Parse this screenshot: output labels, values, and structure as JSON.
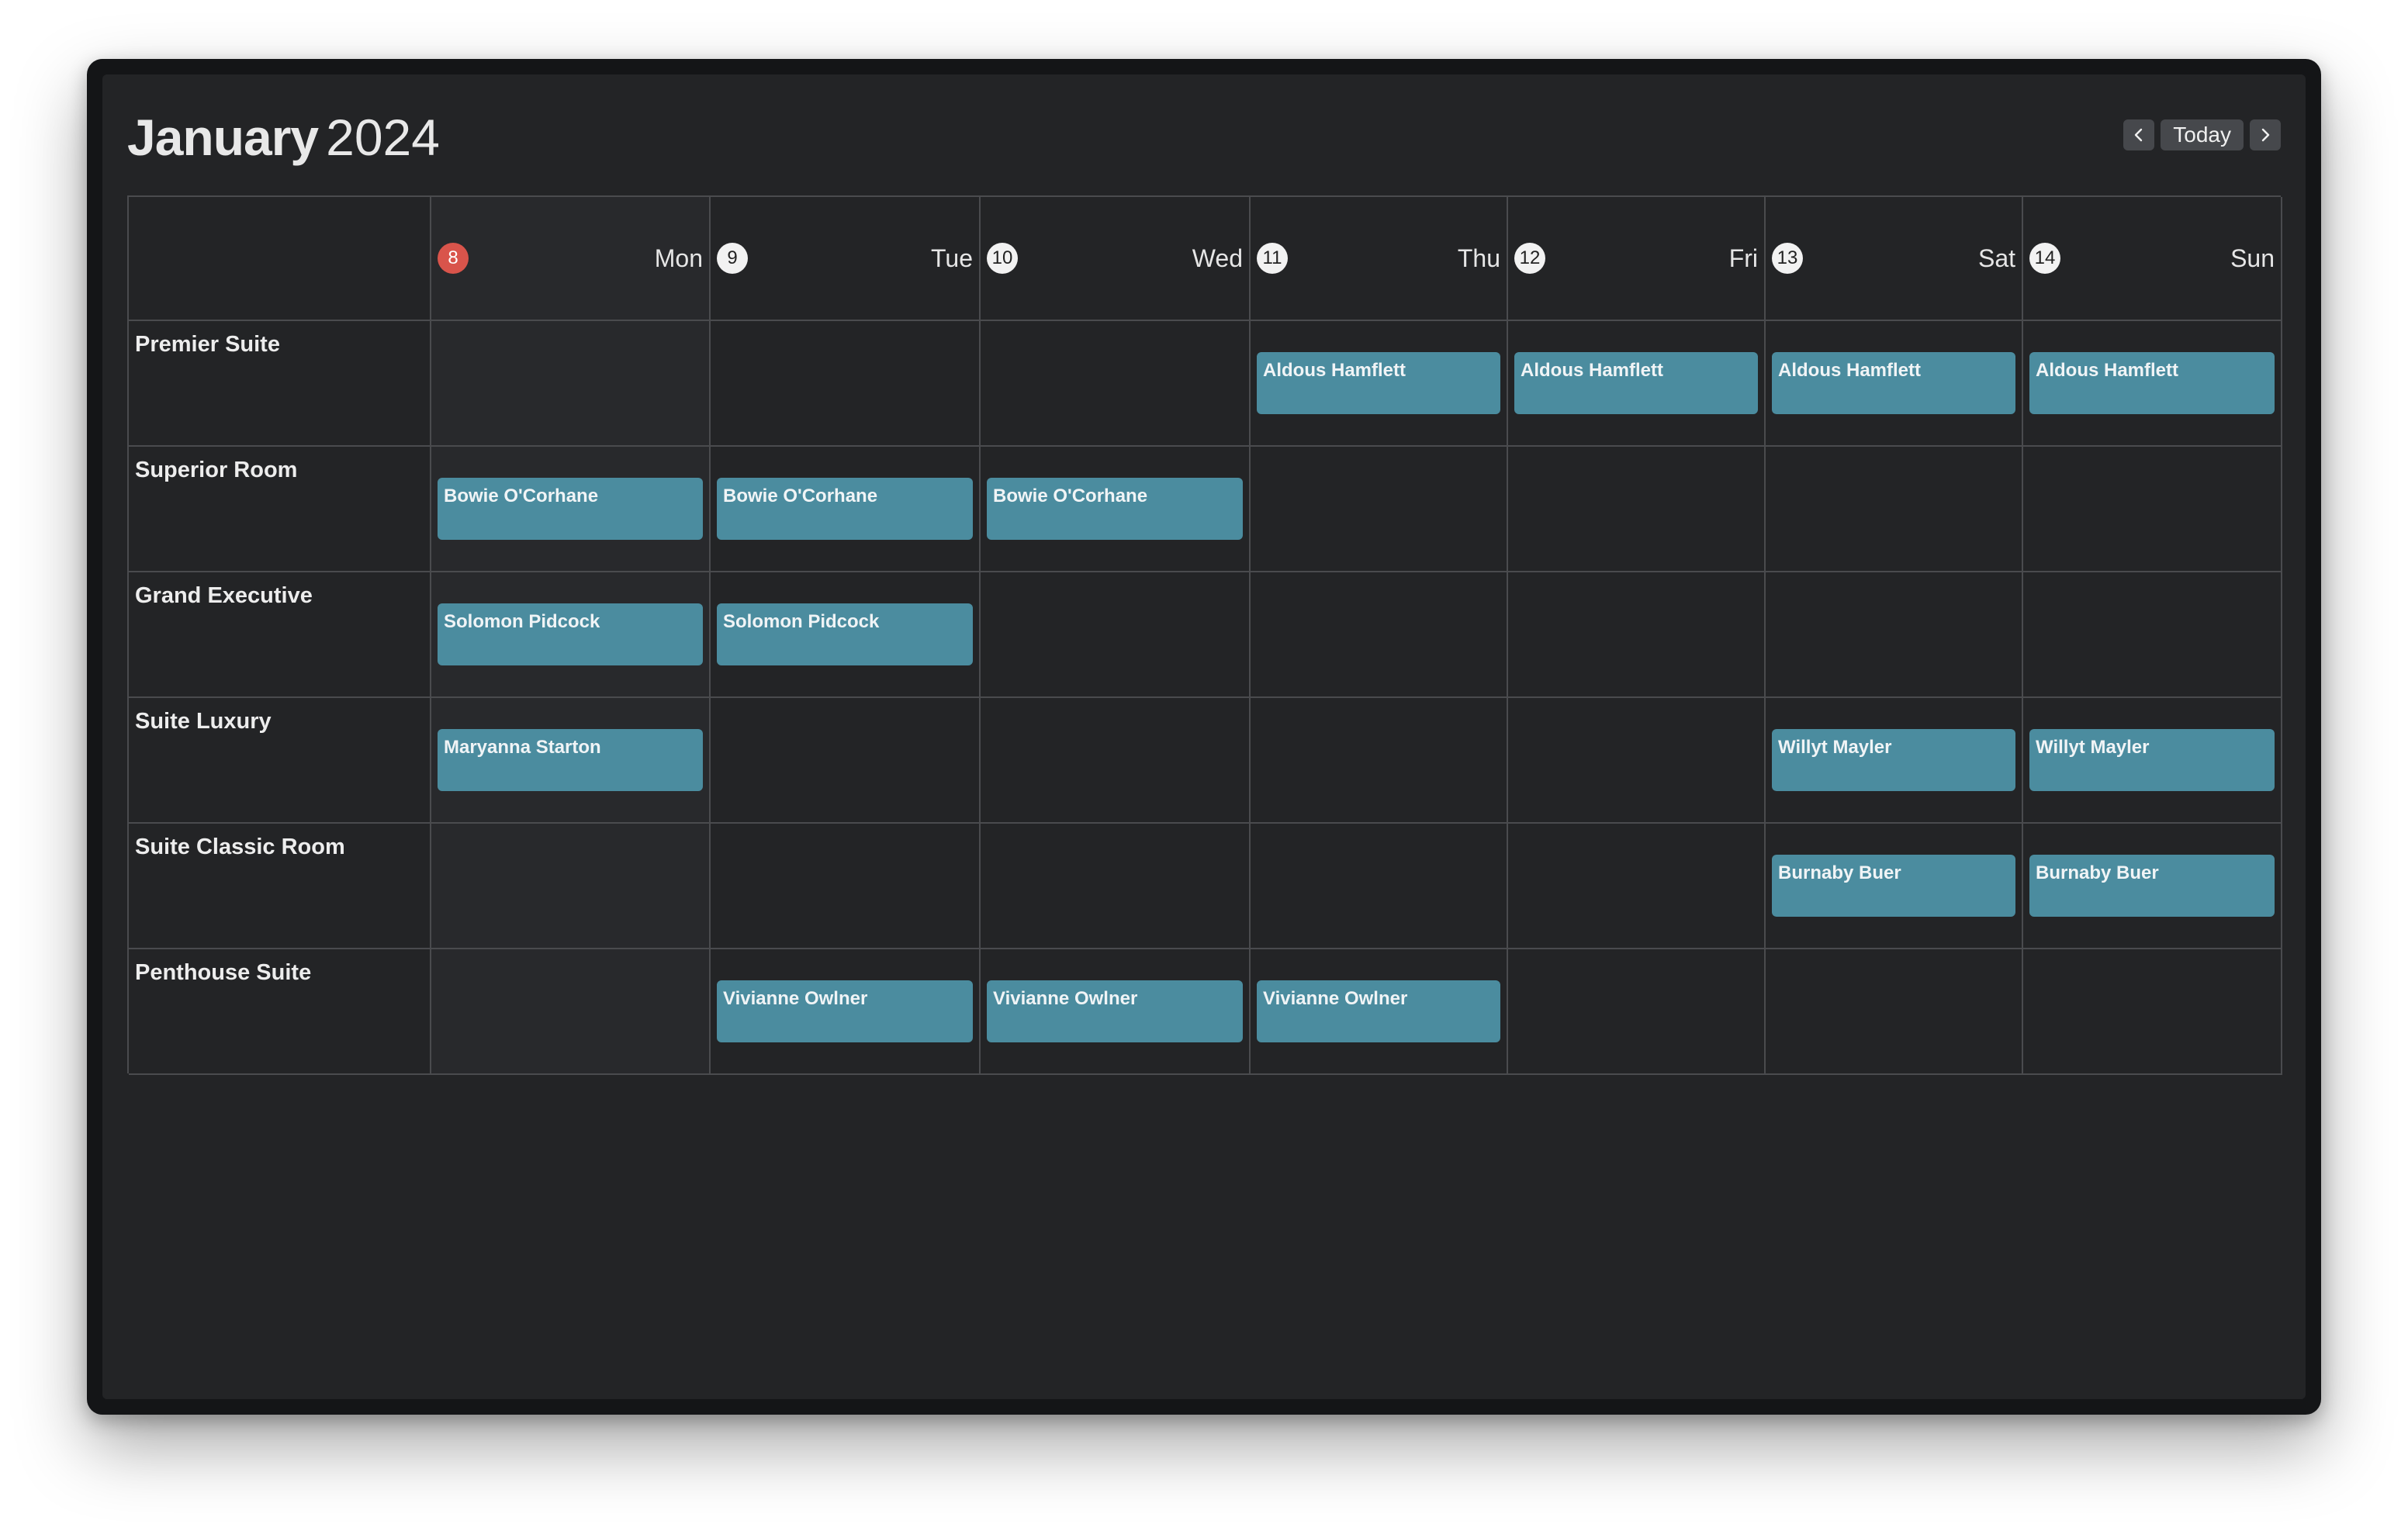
{
  "header": {
    "month": "January",
    "year": "2024",
    "nav": {
      "prev_icon": "chevron-left-icon",
      "today_label": "Today",
      "next_icon": "chevron-right-icon"
    }
  },
  "days": [
    {
      "num": "8",
      "name": "Mon",
      "is_today": true
    },
    {
      "num": "9",
      "name": "Tue",
      "is_today": false
    },
    {
      "num": "10",
      "name": "Wed",
      "is_today": false
    },
    {
      "num": "11",
      "name": "Thu",
      "is_today": false
    },
    {
      "num": "12",
      "name": "Fri",
      "is_today": false
    },
    {
      "num": "13",
      "name": "Sat",
      "is_today": false
    },
    {
      "num": "14",
      "name": "Sun",
      "is_today": false
    }
  ],
  "rooms": [
    {
      "name": "Premier Suite",
      "bookings": [
        "",
        "",
        "",
        "Aldous Hamflett",
        "Aldous Hamflett",
        "Aldous Hamflett",
        "Aldous Hamflett"
      ]
    },
    {
      "name": "Superior Room",
      "bookings": [
        "Bowie O'Corhane",
        "Bowie O'Corhane",
        "Bowie O'Corhane",
        "",
        "",
        "",
        ""
      ]
    },
    {
      "name": "Grand Executive",
      "bookings": [
        "Solomon Pidcock",
        "Solomon Pidcock",
        "",
        "",
        "",
        "",
        ""
      ]
    },
    {
      "name": "Suite Luxury",
      "bookings": [
        "Maryanna Starton",
        "",
        "",
        "",
        "",
        "Willyt Mayler",
        "Willyt Mayler"
      ]
    },
    {
      "name": "Suite Classic Room",
      "bookings": [
        "",
        "",
        "",
        "",
        "",
        "Burnaby Buer",
        "Burnaby Buer"
      ]
    },
    {
      "name": "Penthouse Suite",
      "bookings": [
        "",
        "Vivianne Owlner",
        "Vivianne Owlner",
        "Vivianne Owlner",
        "",
        "",
        ""
      ]
    }
  ],
  "colors": {
    "booking": "#4b8c9f",
    "today_badge": "#d9544b",
    "background": "#232426"
  }
}
